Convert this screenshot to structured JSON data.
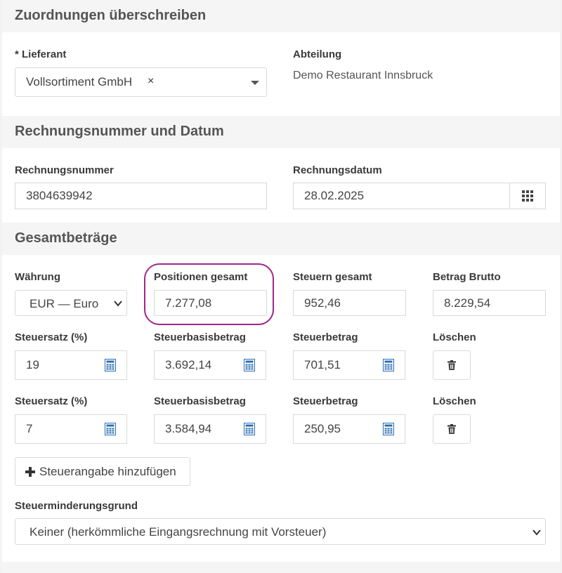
{
  "sections": {
    "assignments_title": "Zuordnungen überschreiben",
    "invoice_title": "Rechnungsnummer und Datum",
    "totals_title": "Gesamtbeträge"
  },
  "supplier": {
    "label": "* Lieferant",
    "value": "Vollsortiment GmbH",
    "clear_symbol": "×"
  },
  "department": {
    "label": "Abteilung",
    "value": "Demo Restaurant Innsbruck"
  },
  "invoice": {
    "number_label": "Rechnungsnummer",
    "number_value": "3804639942",
    "date_label": "Rechnungsdatum",
    "date_value": "28.02.2025"
  },
  "totals": {
    "currency_label": "Währung",
    "currency_value": "EUR — Euro (€)",
    "positions_label": "Positionen gesamt",
    "positions_value": "7.277,08",
    "taxes_label": "Steuern gesamt",
    "taxes_value": "952,46",
    "gross_label": "Betrag Brutto",
    "gross_value": "8.229,54"
  },
  "tax_rows": [
    {
      "rate_label": "Steuersatz (%)",
      "rate_value": "19",
      "base_label": "Steuerbasisbetrag",
      "base_value": "3.692,14",
      "amount_label": "Steuerbetrag",
      "amount_value": "701,51",
      "delete_label": "Löschen"
    },
    {
      "rate_label": "Steuersatz (%)",
      "rate_value": "7",
      "base_label": "Steuerbasisbetrag",
      "base_value": "3.584,94",
      "amount_label": "Steuerbetrag",
      "amount_value": "250,95",
      "delete_label": "Löschen"
    }
  ],
  "add_tax_button": "Steuerangabe hinzufügen",
  "reduction": {
    "label": "Steuerminderungsgrund",
    "value": "Keiner (herkömmliche Eingangsrechnung mit Vorsteuer)"
  },
  "colors": {
    "highlight": "#a0268c",
    "calculator_icon": "#2a6db3"
  }
}
